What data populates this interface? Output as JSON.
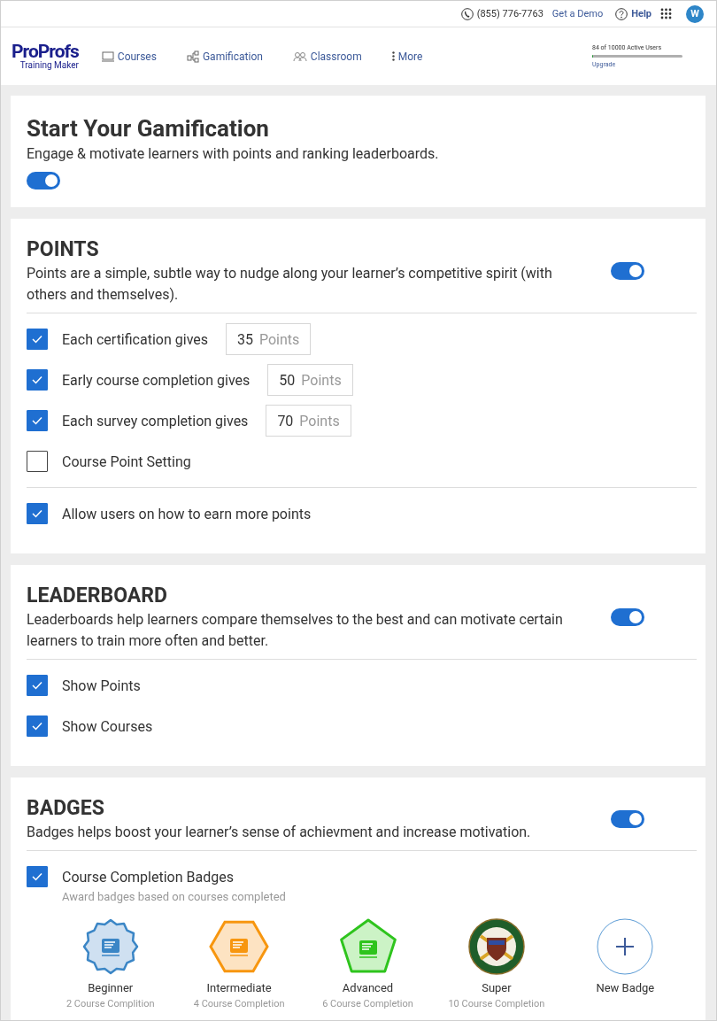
{
  "topbar": {
    "phone": "(855) 776-7763",
    "demo": "Get a Demo",
    "help": "Help",
    "avatar": "W"
  },
  "nav": {
    "logo_top": "ProProfs",
    "logo_bottom": "Training Maker",
    "items": [
      {
        "label": "Courses"
      },
      {
        "label": "Gamification"
      },
      {
        "label": "Classroom"
      },
      {
        "label": "More"
      }
    ],
    "users": "84 of 10000 Active Users",
    "level": 0.01,
    "upgrade": "Upgrade"
  },
  "intro": {
    "title": "Start Your Gamification",
    "description": "Engage & motivate learners with points and ranking leaderboards.",
    "on": true
  },
  "sections": [
    {
      "title": "POINTS",
      "description": "Points are a simple, subtle way to nudge along your learner’s competitive spirit (with others and themselves).",
      "on": true,
      "groups": [
        [
          {
            "kind": "points",
            "label": "Each certification gives",
            "checked": true,
            "value": "35",
            "unit": "Points"
          },
          {
            "kind": "points",
            "label": "Early course completion gives",
            "checked": true,
            "value": "50",
            "unit": "Points"
          },
          {
            "kind": "points",
            "label": "Each survey completion gives",
            "checked": true,
            "value": "70",
            "unit": "Points"
          },
          {
            "kind": "check",
            "label": "Course Point Setting",
            "checked": false
          }
        ],
        [
          {
            "kind": "check",
            "label": "Allow users on how to earn more points",
            "checked": true
          }
        ]
      ]
    },
    {
      "title": "LEADERBOARD",
      "description": "Leaderboards help learners compare themselves to the best and can motivate certain learners to train more often and better.",
      "on": true,
      "groups": [
        [
          {
            "kind": "check",
            "label": "Show Points",
            "checked": true
          },
          {
            "kind": "check",
            "label": "Show Courses",
            "checked": true
          }
        ]
      ]
    },
    {
      "title": "BADGES",
      "description": "Badges helps boost your learner’s sense of achievment and increase motivation.",
      "on": true,
      "groups": [
        [
          {
            "kind": "check",
            "label": "Course Completion Badges",
            "checked": true,
            "hint": "Award badges based on courses completed"
          }
        ]
      ],
      "badges": [
        {
          "kind": "badge",
          "name": "Beginner",
          "detail": "2 Course Complition"
        },
        {
          "kind": "badge",
          "name": "Intermediate",
          "detail": "4 Course Completion"
        },
        {
          "kind": "badge",
          "name": "Advanced",
          "detail": "6 Course Completion"
        },
        {
          "kind": "badge",
          "name": "Super",
          "detail": "10 Course Completion"
        },
        {
          "kind": "add",
          "name": "New Badge"
        }
      ]
    }
  ]
}
